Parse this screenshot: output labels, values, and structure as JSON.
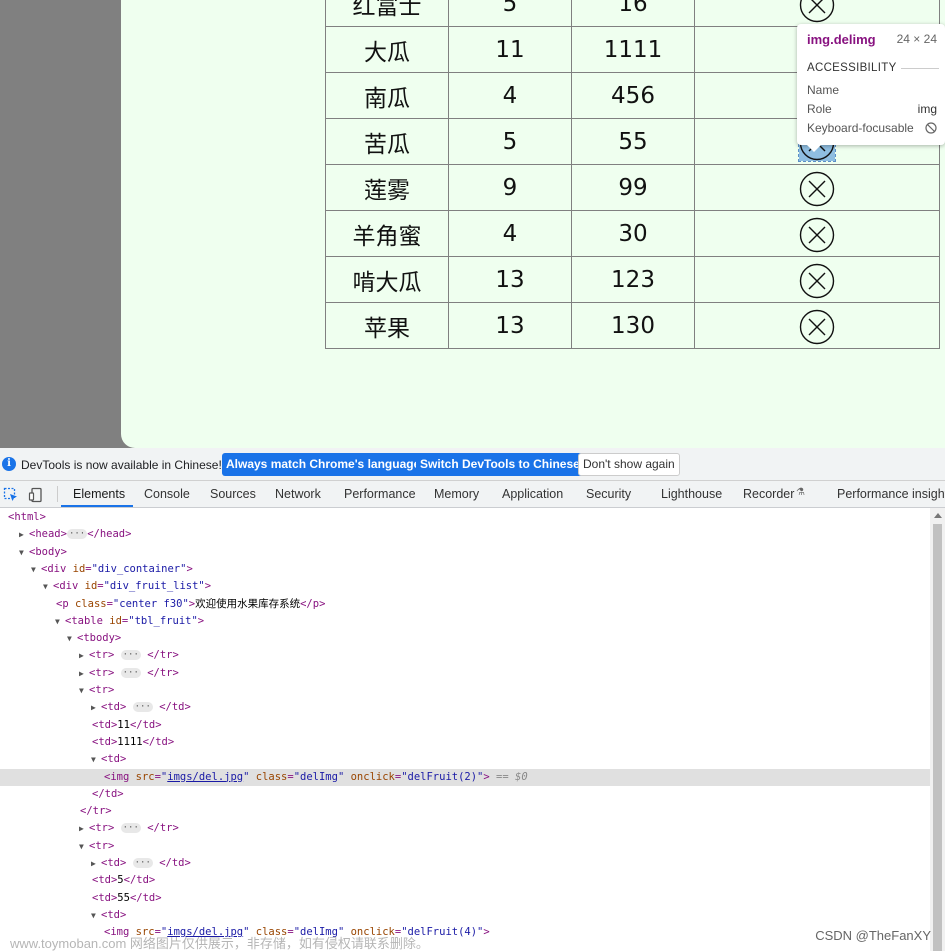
{
  "fruit_table": {
    "rows": [
      {
        "name": "红富士",
        "price": "5",
        "count": "16",
        "selected": false
      },
      {
        "name": "大瓜",
        "price": "11",
        "count": "1111",
        "selected": false
      },
      {
        "name": "南瓜",
        "price": "4",
        "count": "456",
        "selected": false
      },
      {
        "name": "苦瓜",
        "price": "5",
        "count": "55",
        "selected": true
      },
      {
        "name": "莲雾",
        "price": "9",
        "count": "99",
        "selected": false
      },
      {
        "name": "羊角蜜",
        "price": "4",
        "count": "30",
        "selected": false
      },
      {
        "name": "啃大瓜",
        "price": "13",
        "count": "123",
        "selected": false
      },
      {
        "name": "苹果",
        "price": "13",
        "count": "130",
        "selected": false
      }
    ],
    "delete_icon": "circle-x-icon"
  },
  "tooltip": {
    "title": "img.delimg",
    "size": "24 × 24",
    "section": "ACCESSIBILITY",
    "name_label": "Name",
    "role_label": "Role",
    "role_value": "img",
    "focusable_label": "Keyboard-focusable",
    "focusable_icon": "not-allowed-icon"
  },
  "banner": {
    "message": "DevTools is now available in Chinese!",
    "btn_match": "Always match Chrome's language",
    "btn_switch": "Switch DevTools to Chinese",
    "btn_dismiss": "Don't show again"
  },
  "tabs": [
    "Elements",
    "Console",
    "Sources",
    "Network",
    "Performance",
    "Memory",
    "Application",
    "Security",
    "Lighthouse",
    "Recorder",
    "Performance insights"
  ],
  "active_tab": "Elements",
  "dom_tree": [
    {
      "indent": 0,
      "tw": "",
      "html": "<span class=\"tag\">&lt;html&gt;</span>"
    },
    {
      "indent": 1,
      "tw": "▶",
      "html": "<span class=\"tag\">&lt;head&gt;</span><span class=\"ellipsis\">···</span><span class=\"tag\">&lt;/head&gt;</span>"
    },
    {
      "indent": 1,
      "tw": "▼",
      "html": "<span class=\"tag\">&lt;body&gt;</span>"
    },
    {
      "indent": 2,
      "tw": "▼",
      "html": "<span class=\"tag\">&lt;div</span> <span class=\"attr\">id</span><span class=\"tag\">=</span><span class=\"aval\">\"div_container\"</span><span class=\"tag\">&gt;</span>"
    },
    {
      "indent": 3,
      "tw": "▼",
      "html": "<span class=\"tag\">&lt;div</span> <span class=\"attr\">id</span><span class=\"tag\">=</span><span class=\"aval\">\"div_fruit_list\"</span><span class=\"tag\">&gt;</span>"
    },
    {
      "indent": 4,
      "tw": "",
      "html": "<span class=\"tag\">&lt;p</span> <span class=\"attr\">class</span><span class=\"tag\">=</span><span class=\"aval\">\"center f30\"</span><span class=\"tag\">&gt;</span><span class=\"text\">欢迎使用水果库存系统</span><span class=\"tag\">&lt;/p&gt;</span>"
    },
    {
      "indent": 4,
      "tw": "▼",
      "html": "<span class=\"tag\">&lt;table</span> <span class=\"attr\">id</span><span class=\"tag\">=</span><span class=\"aval\">\"tbl_fruit\"</span><span class=\"tag\">&gt;</span>"
    },
    {
      "indent": 5,
      "tw": "▼",
      "html": "<span class=\"tag\">&lt;tbody&gt;</span>"
    },
    {
      "indent": 6,
      "tw": "▶",
      "html": "<span class=\"tag\">&lt;tr&gt;</span> <span class=\"ellipsis\">···</span> <span class=\"tag\">&lt;/tr&gt;</span>"
    },
    {
      "indent": 6,
      "tw": "▶",
      "html": "<span class=\"tag\">&lt;tr&gt;</span> <span class=\"ellipsis\">···</span> <span class=\"tag\">&lt;/tr&gt;</span>"
    },
    {
      "indent": 6,
      "tw": "▼",
      "html": "<span class=\"tag\">&lt;tr&gt;</span>"
    },
    {
      "indent": 7,
      "tw": "▶",
      "html": "<span class=\"tag\">&lt;td&gt;</span> <span class=\"ellipsis\">···</span> <span class=\"tag\">&lt;/td&gt;</span>"
    },
    {
      "indent": 7,
      "tw": "",
      "html": "<span class=\"tag\">&lt;td&gt;</span><span class=\"text\">11</span><span class=\"tag\">&lt;/td&gt;</span>"
    },
    {
      "indent": 7,
      "tw": "",
      "html": "<span class=\"tag\">&lt;td&gt;</span><span class=\"text\">1111</span><span class=\"tag\">&lt;/td&gt;</span>"
    },
    {
      "indent": 7,
      "tw": "▼",
      "html": "<span class=\"tag\">&lt;td&gt;</span>"
    },
    {
      "indent": 8,
      "tw": "",
      "selected": true,
      "html": "<span class=\"tag\">&lt;img</span> <span class=\"attr\">src</span><span class=\"tag\">=</span><span class=\"aval\">\"<span class=\"link\">imgs/del.jpg</span>\"</span> <span class=\"attr\">class</span><span class=\"tag\">=</span><span class=\"aval\">\"delImg\"</span> <span class=\"attr\">onclick</span><span class=\"tag\">=</span><span class=\"aval\">\"delFruit(2)\"</span><span class=\"tag\">&gt;</span> <span class=\"eq\">== $0</span>"
    },
    {
      "indent": 7,
      "tw": "",
      "html": "<span class=\"tag\">&lt;/td&gt;</span>"
    },
    {
      "indent": 6,
      "tw": "",
      "html": "<span class=\"tag\">&lt;/tr&gt;</span>"
    },
    {
      "indent": 6,
      "tw": "▶",
      "html": "<span class=\"tag\">&lt;tr&gt;</span> <span class=\"ellipsis\">···</span> <span class=\"tag\">&lt;/tr&gt;</span>"
    },
    {
      "indent": 6,
      "tw": "▼",
      "html": "<span class=\"tag\">&lt;tr&gt;</span>"
    },
    {
      "indent": 7,
      "tw": "▶",
      "html": "<span class=\"tag\">&lt;td&gt;</span> <span class=\"ellipsis\">···</span> <span class=\"tag\">&lt;/td&gt;</span>"
    },
    {
      "indent": 7,
      "tw": "",
      "html": "<span class=\"tag\">&lt;td&gt;</span><span class=\"text\">5</span><span class=\"tag\">&lt;/td&gt;</span>"
    },
    {
      "indent": 7,
      "tw": "",
      "html": "<span class=\"tag\">&lt;td&gt;</span><span class=\"text\">55</span><span class=\"tag\">&lt;/td&gt;</span>"
    },
    {
      "indent": 7,
      "tw": "▼",
      "html": "<span class=\"tag\">&lt;td&gt;</span>"
    },
    {
      "indent": 8,
      "tw": "",
      "html": "<span class=\"tag\">&lt;img</span> <span class=\"attr\">src</span><span class=\"tag\">=</span><span class=\"aval\">\"<span class=\"link\">imgs/del.jpg</span>\"</span> <span class=\"attr\">class</span><span class=\"tag\">=</span><span class=\"aval\">\"delImg\"</span> <span class=\"attr\">onclick</span><span class=\"tag\">=</span><span class=\"aval\">\"delFruit(4)\"</span><span class=\"tag\">&gt;</span>"
    }
  ],
  "watermark_left": "www.toymoban.com 网络图片仅供展示，非存储，如有侵权请联系删除。",
  "watermark_right": "CSDN @TheFanXY"
}
